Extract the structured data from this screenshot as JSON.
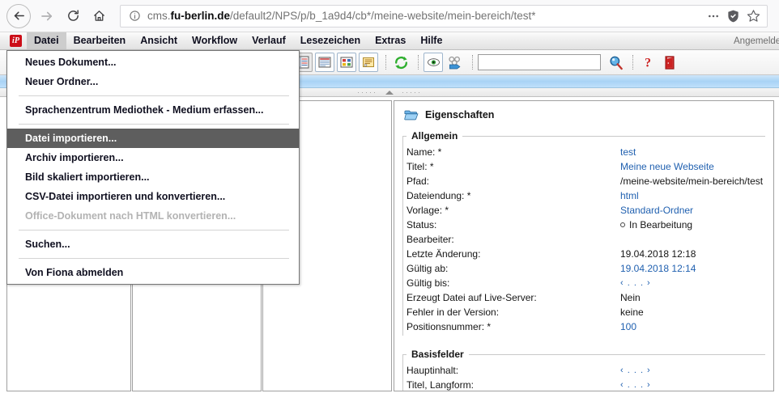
{
  "browser": {
    "back_icon": "arrow-left-icon",
    "forward_icon": "arrow-right-icon",
    "reload_icon": "reload-icon",
    "home_icon": "home-icon",
    "url_host_prefix": "cms.",
    "url_host_strong": "fu-berlin.de",
    "url_path": "/default2/NPS/p/b_1a9d4/cb*/meine-website/mein-bereich/test*",
    "info_icon": "site-info-icon",
    "menu_icon": "page-actions-icon",
    "shield_icon": "tracking-protection-icon",
    "bookmark_icon": "bookmark-star-icon"
  },
  "appbar": {
    "logo_label": "iP",
    "items": [
      {
        "label": "Datei",
        "active": true
      },
      {
        "label": "Bearbeiten",
        "active": false
      },
      {
        "label": "Ansicht",
        "active": false
      },
      {
        "label": "Workflow",
        "active": false
      },
      {
        "label": "Verlauf",
        "active": false
      },
      {
        "label": "Lesezeichen",
        "active": false
      },
      {
        "label": "Extras",
        "active": false
      },
      {
        "label": "Hilfe",
        "active": false
      }
    ],
    "logged_in": "Angemeldet"
  },
  "dropdown": {
    "items": [
      {
        "label": "Neues Dokument...",
        "state": "normal"
      },
      {
        "label": "Neuer Ordner...",
        "state": "normal"
      },
      {
        "separator": true
      },
      {
        "label": "Sprachenzentrum Mediothek - Medium erfassen...",
        "state": "normal"
      },
      {
        "separator": true
      },
      {
        "label": "Datei importieren...",
        "state": "highlight"
      },
      {
        "label": "Archiv importieren...",
        "state": "normal"
      },
      {
        "label": "Bild skaliert importieren...",
        "state": "normal"
      },
      {
        "label": "CSV-Datei importieren und konvertieren...",
        "state": "normal"
      },
      {
        "label": "Office-Dokument nach HTML konvertieren...",
        "state": "disabled"
      },
      {
        "separator": true
      },
      {
        "label": "Suchen...",
        "state": "normal"
      },
      {
        "separator": true
      },
      {
        "label": "Von Fiona abmelden",
        "state": "normal"
      }
    ]
  },
  "toolbar": {
    "buttons": [
      {
        "icon": "list-view-icon",
        "style": "pressed"
      },
      {
        "icon": "detail-view-icon",
        "style": "framed"
      },
      {
        "icon": "thumbnail-view-icon",
        "style": "framed"
      },
      {
        "icon": "notes-view-icon",
        "style": "framed"
      },
      {
        "icon": "refresh-icon",
        "style": "plain"
      },
      {
        "icon": "preview-eye-icon",
        "style": "framed"
      },
      {
        "icon": "publish-icon",
        "style": "plain"
      },
      {
        "icon": "search-go-icon",
        "style": "plain"
      },
      {
        "icon": "help-question-icon",
        "style": "plain"
      },
      {
        "icon": "logout-door-icon",
        "style": "plain"
      }
    ],
    "search_value": "",
    "search_placeholder": ""
  },
  "properties": {
    "header": "Eigenschaften",
    "header_icon": "folder-open-icon",
    "groups": [
      {
        "legend": "Allgemein",
        "rows": [
          {
            "label": "Name: *",
            "value": "test",
            "kind": "link"
          },
          {
            "label": "Titel: *",
            "value": "Meine neue Webseite",
            "kind": "link"
          },
          {
            "label": "Pfad:",
            "value": "/meine-website/mein-bereich/test",
            "kind": "plain"
          },
          {
            "label": "Dateiendung: *",
            "value": "html",
            "kind": "link"
          },
          {
            "label": "Vorlage: *",
            "value": "Standard-Ordner",
            "kind": "link"
          },
          {
            "label": "Status:",
            "value": "In Bearbeitung",
            "kind": "status"
          },
          {
            "label": "Bearbeiter:",
            "value": "",
            "kind": "plain"
          },
          {
            "label": "Letzte Änderung:",
            "value": "19.04.2018 12:18",
            "kind": "plain"
          },
          {
            "label": "Gültig ab:",
            "value": "19.04.2018 12:14",
            "kind": "link"
          },
          {
            "label": "Gültig bis:",
            "value": "‹ . . . ›",
            "kind": "ellipsis"
          },
          {
            "label": "Erzeugt Datei auf Live-Server:",
            "value": "Nein",
            "kind": "plain"
          },
          {
            "label": "Fehler in der Version:",
            "value": "keine",
            "kind": "plain"
          },
          {
            "label": "Positionsnummer: *",
            "value": "100",
            "kind": "link"
          }
        ]
      },
      {
        "legend": "Basisfelder",
        "rows": [
          {
            "label": "Hauptinhalt:",
            "value": "‹ . . . ›",
            "kind": "ellipsis"
          },
          {
            "label": "Titel, Langform:",
            "value": "‹ . . . ›",
            "kind": "ellipsis"
          }
        ]
      }
    ]
  },
  "colors": {
    "accent_link": "#2161b0",
    "brand_red": "#cc0e18",
    "menu_highlight": "#5e5e5e",
    "band_blue": "#a9d3f5"
  }
}
